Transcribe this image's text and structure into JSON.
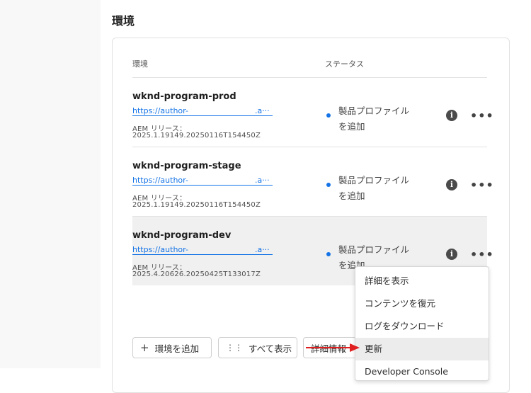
{
  "section_title": "環境",
  "table": {
    "col_environment": "環境",
    "col_status": "ステータス"
  },
  "environments": [
    {
      "name": "wknd-program-prod",
      "link_prefix": "https://author-",
      "link_suffix": ".a···",
      "aem_label": "AEM リリース：",
      "aem_version": "2025.1.19149.20250116T154450Z",
      "status_line1": "製品プロファイル",
      "status_line2": "を追加"
    },
    {
      "name": "wknd-program-stage",
      "link_prefix": "https://author-",
      "link_suffix": ".a···",
      "aem_label": "AEM リリース：",
      "aem_version": "2025.1.19149.20250116T154450Z",
      "status_line1": "製品プロファイル",
      "status_line2": "を追加"
    },
    {
      "name": "wknd-program-dev",
      "link_prefix": "https://author-",
      "link_suffix": ".a···",
      "aem_label": "AEM リリース：",
      "aem_version": "2025.4.20626.20250425T133017Z",
      "status_line1": "製品プロファイル",
      "status_line2": "を追加"
    }
  ],
  "icons": {
    "info": "i",
    "more": "•••",
    "plus": "+",
    "show_all": "⋮⋮"
  },
  "colors": {
    "accent": "#1473e6",
    "annotation_arrow": "#e02020"
  },
  "buttons": {
    "add_env": "環境を追加",
    "show_all": "すべて表示",
    "details": "詳細情報"
  },
  "menu": {
    "items": [
      "詳細を表示",
      "コンテンツを復元",
      "ログをダウンロード",
      "更新",
      "Developer Console"
    ]
  }
}
